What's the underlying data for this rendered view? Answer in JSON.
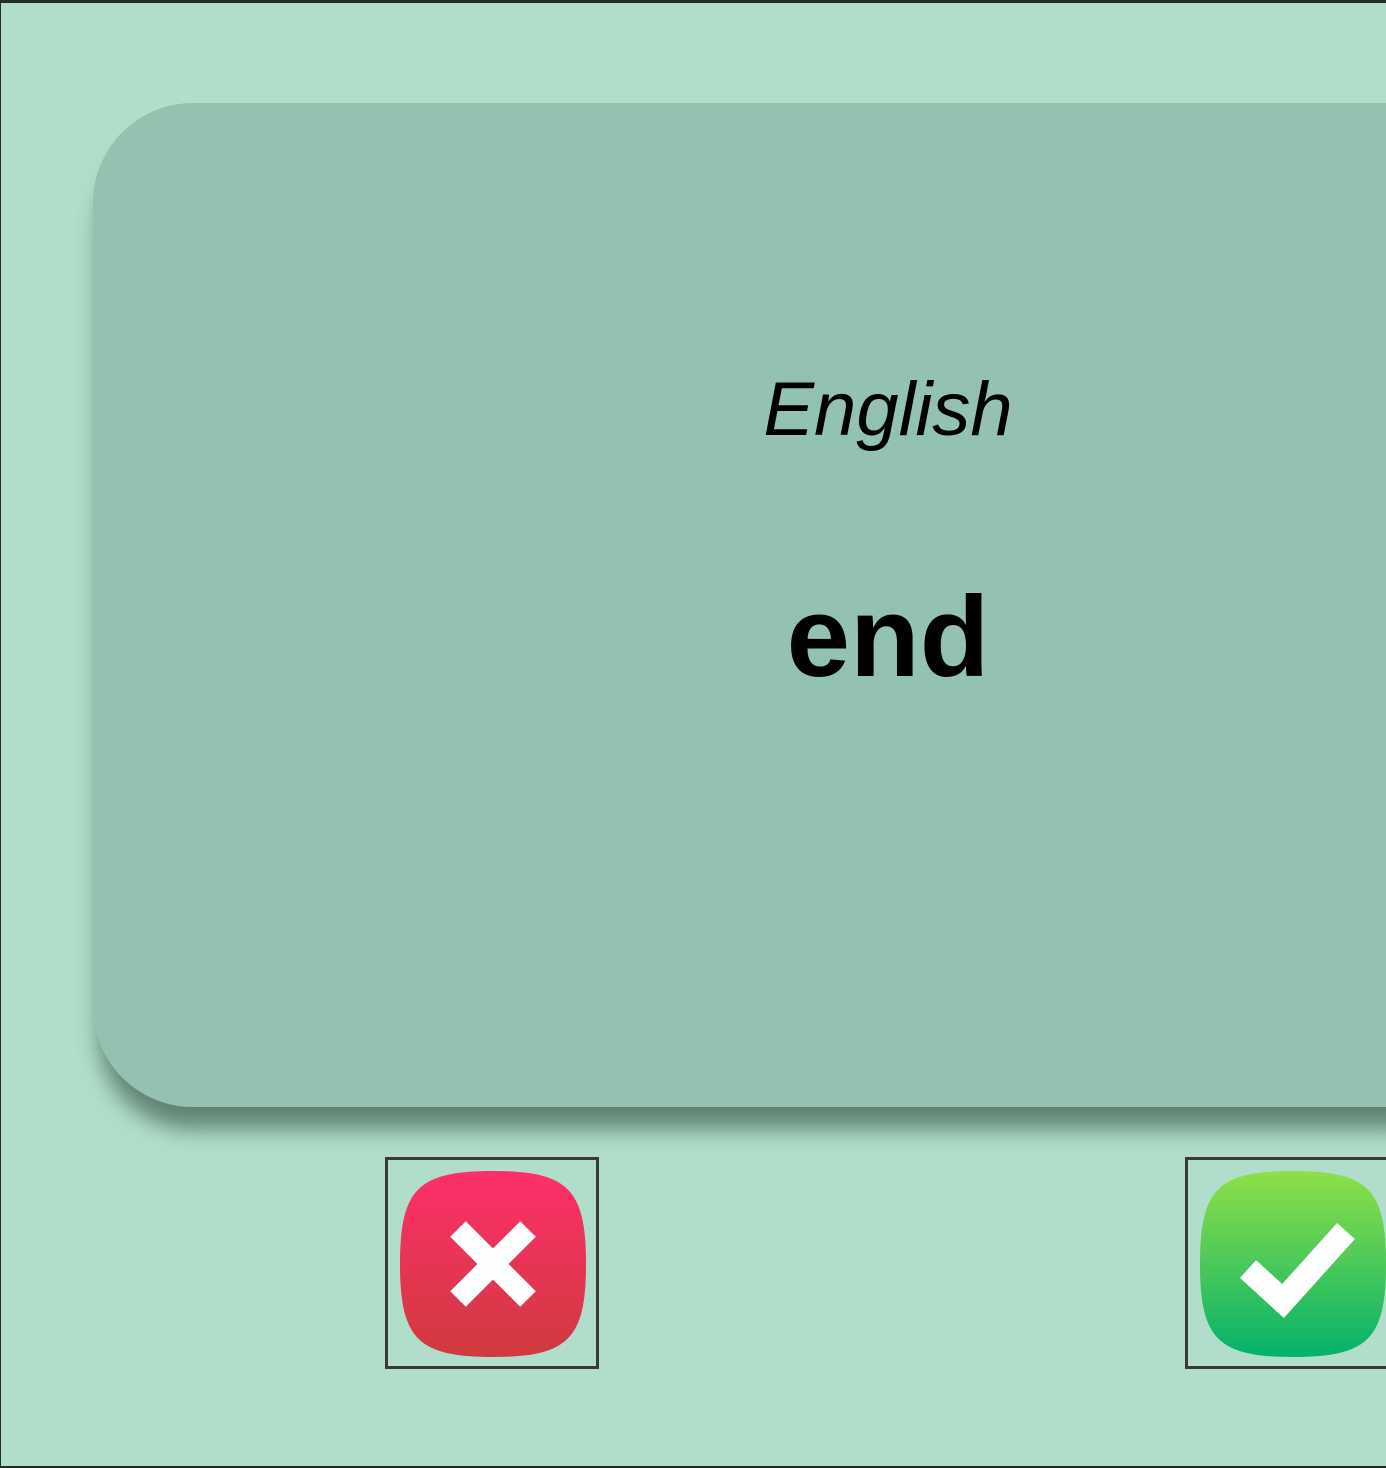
{
  "card": {
    "language": "English",
    "word": "end"
  },
  "actions": {
    "reject": {
      "icon": "close-icon",
      "color_top": "#fd2f6a",
      "color_bottom": "#d03a3e"
    },
    "accept": {
      "icon": "check-icon",
      "color_top": "#8fe047",
      "color_bottom": "#05b16c"
    }
  },
  "colors": {
    "background": "#b1decb",
    "card": "#93c3b0"
  }
}
